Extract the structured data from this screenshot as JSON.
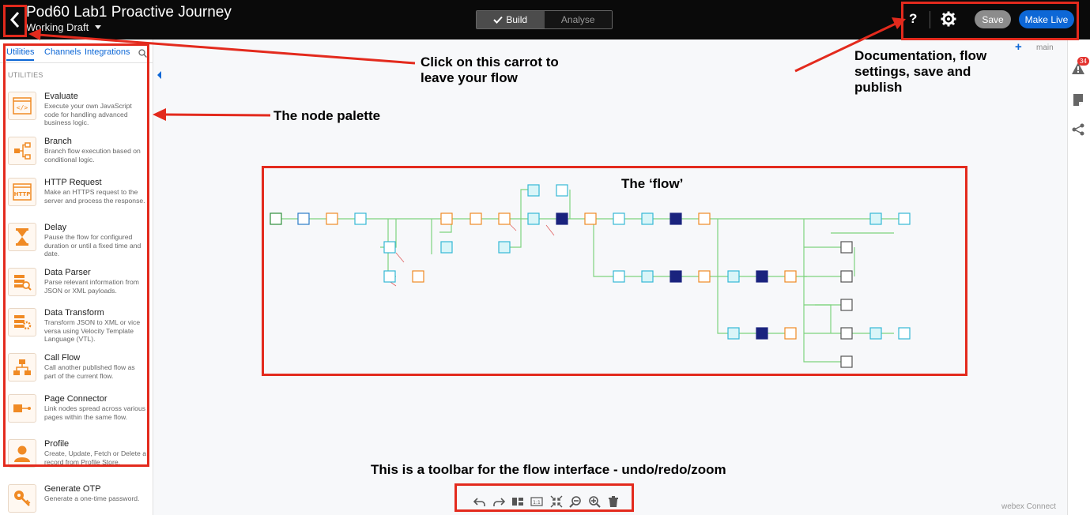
{
  "header": {
    "title": "Pod60 Lab1 Proactive Journey",
    "status": "Working Draft",
    "modes": [
      "Build",
      "Analyse"
    ],
    "help": "?",
    "save_label": "Save",
    "live_label": "Make Live"
  },
  "sidebar": {
    "tabs": [
      "Utilities",
      "Channels",
      "Integrations"
    ],
    "section": "UTILITIES",
    "nodes": [
      {
        "name": "Evaluate",
        "desc": "Execute your own JavaScript code for handling advanced business logic."
      },
      {
        "name": "Branch",
        "desc": "Branch flow execution based on conditional logic."
      },
      {
        "name": "HTTP Request",
        "desc": "Make an HTTPS request to the server and process the response."
      },
      {
        "name": "Delay",
        "desc": "Pause the flow for configured duration or until a fixed time and date."
      },
      {
        "name": "Data Parser",
        "desc": "Parse relevant information from JSON or XML payloads."
      },
      {
        "name": "Data Transform",
        "desc": "Transform JSON to XML or vice versa using Velocity Template Language (VTL)."
      },
      {
        "name": "Call Flow",
        "desc": "Call another published flow as part of the current flow."
      },
      {
        "name": "Page Connector",
        "desc": "Link nodes spread across various pages within the same flow."
      },
      {
        "name": "Profile",
        "desc": "Create, Update, Fetch or Delete a record from Profile Store."
      },
      {
        "name": "Generate OTP",
        "desc": "Generate a one-time password."
      }
    ]
  },
  "canvas": {
    "page": "main",
    "alert_count": "34",
    "brand": "webex Connect"
  },
  "annotations": {
    "carrot": "Click on this carrot to leave your flow",
    "palette": "The node palette",
    "flow": "The ‘flow’",
    "settings": "Documentation, flow settings, save and publish",
    "toolbar": "This is a toolbar for the flow interface - undo/redo/zoom"
  },
  "colors": {
    "accent": "#0d67d6",
    "annotation_red": "#e32a1d",
    "node_orange": "#f08a24",
    "edge_green": "#7ed37e"
  },
  "icons": {
    "back": "chevron-left-icon",
    "settings": "gear-icon",
    "search": "search-icon",
    "undo": "undo-icon",
    "redo": "redo-icon",
    "zoom_in": "zoom-in-icon",
    "zoom_out": "zoom-out-icon",
    "delete": "trash-icon"
  }
}
